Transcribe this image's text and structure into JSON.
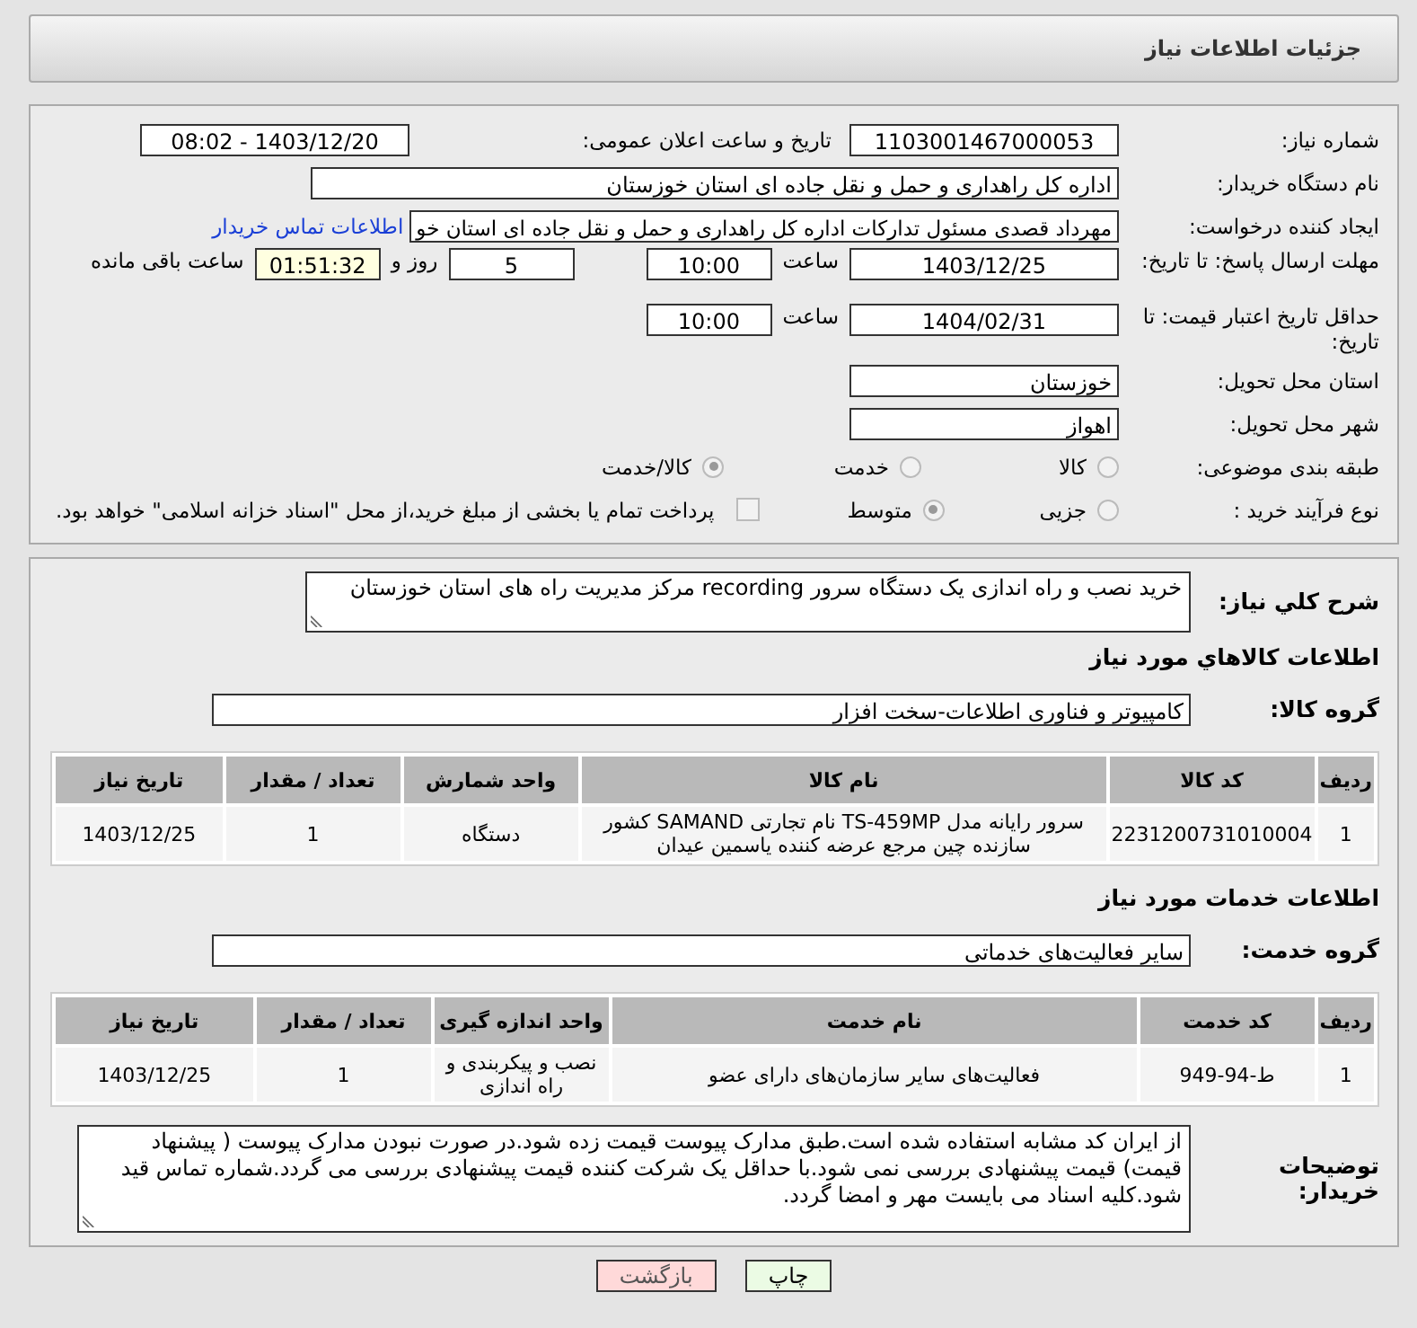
{
  "header": {
    "title": "جزئیات اطلاعات نیاز"
  },
  "need_number": {
    "label": "شماره نیاز:",
    "value": "1103001467000053"
  },
  "announce_datetime": {
    "label": "تاریخ و ساعت اعلان عمومی:",
    "value": "1403/12/20 - 08:02"
  },
  "buyer_org": {
    "label": "نام دستگاه خریدار:",
    "value": "اداره کل راهداری و حمل و نقل جاده ای استان خوزستان"
  },
  "requester": {
    "label": "ایجاد کننده درخواست:",
    "value": "مهرداد قصدی مسئول تدارکات اداره کل راهداری و حمل و نقل جاده ای استان خو",
    "link": "اطلاعات تماس خریدار"
  },
  "reply_deadline": {
    "label": "مهلت ارسال پاسخ: تا تاریخ:",
    "date": "1403/12/25",
    "time_label": "ساعت",
    "time": "10:00",
    "days": "5",
    "days_label": "روز و",
    "remaining": "01:51:32",
    "remaining_label": "ساعت باقی مانده"
  },
  "price_validity": {
    "label": "حداقل تاریخ اعتبار قیمت: تا تاریخ:",
    "date": "1404/02/31",
    "time_label": "ساعت",
    "time": "10:00"
  },
  "province": {
    "label": "استان محل تحویل:",
    "value": "خوزستان"
  },
  "city": {
    "label": "شهر محل تحویل:",
    "value": "اهواز"
  },
  "category": {
    "label": "طبقه بندی موضوعی:",
    "options": [
      {
        "label": "کالا",
        "selected": false
      },
      {
        "label": "خدمت",
        "selected": false
      },
      {
        "label": "کالا/خدمت",
        "selected": true
      }
    ]
  },
  "process": {
    "label": "نوع فرآیند خرید :",
    "options": [
      {
        "label": "جزیی",
        "selected": false
      },
      {
        "label": "متوسط",
        "selected": true
      }
    ],
    "treasury": {
      "label": "پرداخت تمام یا بخشی از مبلغ خرید،از محل \"اسناد خزانه اسلامی\" خواهد بود.",
      "checked": false
    }
  },
  "description": {
    "label": "شرح کلي نياز:",
    "value": "خرید نصب و راه اندازی یک دستگاه سرور recording مرکز مدیریت راه های استان خوزستان"
  },
  "goods": {
    "heading": "اطلاعات کالاهاي مورد نياز",
    "group_label": "گروه کالا:",
    "group": "کامپیوتر و فناوری اطلاعات-سخت افزار",
    "columns": [
      "ردیف",
      "کد کالا",
      "نام کالا",
      "واحد شمارش",
      "تعداد / مقدار",
      "تاریخ نیاز"
    ],
    "rows": [
      [
        "1",
        "2231200731010004",
        "سرور رایانه مدل TS-459MP نام تجارتی SAMAND کشور سازنده چین مرجع عرضه کننده یاسمین عیدان",
        "دستگاه",
        "1",
        "1403/12/25"
      ]
    ]
  },
  "services": {
    "heading": "اطلاعات خدمات مورد نیاز",
    "group_label": "گروه خدمت:",
    "group": "سایر فعالیت‌های خدماتی",
    "columns": [
      "ردیف",
      "کد خدمت",
      "نام خدمت",
      "واحد اندازه گیری",
      "تعداد / مقدار",
      "تاریخ نیاز"
    ],
    "rows": [
      [
        "1",
        "ط-94-949",
        "فعالیت‌های سایر سازمان‌های دارای عضو",
        "نصب و پیکربندی و راه اندازی",
        "1",
        "1403/12/25"
      ]
    ]
  },
  "buyer_notes": {
    "label": "توضیحات خریدار:",
    "value": "از ایران کد مشابه استفاده شده است.طبق مدارک پیوست قیمت زده شود.در صورت نبودن مدارک پیوست ( پیشنهاد قیمت) قیمت پیشنهادی بررسی نمی شود.با حداقل یک شرکت کننده قیمت پیشنهادی بررسی می گردد.شماره تماس قید شود.کلیه اسناد می بایست مهر و امضا گردد."
  },
  "buttons": [
    {
      "label": "چاپ",
      "kind": "print"
    },
    {
      "label": "بازگشت",
      "kind": "back"
    }
  ]
}
